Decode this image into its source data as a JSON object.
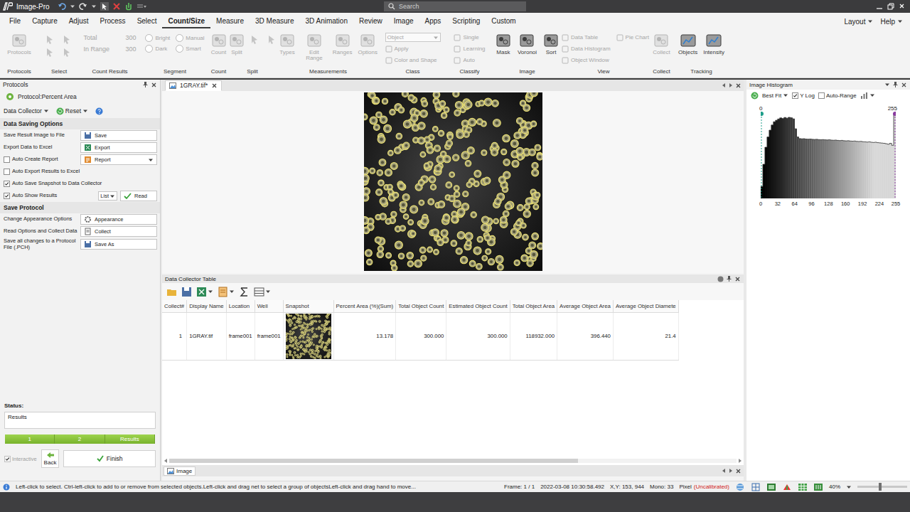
{
  "window": {
    "title": "Image-Pro",
    "search": "Search"
  },
  "menu": {
    "tabs": [
      {
        "label": "File",
        "selected": false
      },
      {
        "label": "Capture",
        "selected": false
      },
      {
        "label": "Adjust",
        "selected": false
      },
      {
        "label": "Process",
        "selected": false
      },
      {
        "label": "Select",
        "selected": false
      },
      {
        "label": "Count/Size",
        "selected": true
      },
      {
        "label": "Measure",
        "selected": false
      },
      {
        "label": "3D Measure",
        "selected": false
      },
      {
        "label": "3D Animation",
        "selected": false
      },
      {
        "label": "Review",
        "selected": false
      },
      {
        "label": "Image",
        "selected": false
      },
      {
        "label": "Apps",
        "selected": false
      },
      {
        "label": "Scripting",
        "selected": false
      },
      {
        "label": "Custom",
        "selected": false
      }
    ],
    "right": [
      "Layout",
      "Help"
    ]
  },
  "ribbon": [
    {
      "label": "Protocols",
      "items": [
        {
          "kind": "large",
          "text": "Protocols",
          "disabled": true
        }
      ]
    },
    {
      "label": "Select",
      "items": [
        {
          "kind": "icon",
          "disabled": true
        },
        {
          "kind": "icon",
          "disabled": true
        },
        {
          "kind": "icon",
          "disabled": true
        },
        {
          "kind": "icon",
          "disabled": true
        }
      ]
    },
    {
      "label": "Count Results",
      "items": [
        {
          "kind": "value",
          "text": "Total",
          "value": "300",
          "disabled": true
        },
        {
          "kind": "value",
          "text": "In Range",
          "value": "300",
          "disabled": true
        }
      ]
    },
    {
      "label": "Segment",
      "items": [
        {
          "kind": "radio",
          "text": "Bright",
          "selected": false,
          "disabled": true
        },
        {
          "kind": "radio",
          "text": "Manual",
          "selected": false,
          "disabled": true
        },
        {
          "kind": "radio",
          "text": "Dark",
          "selected": false,
          "disabled": true
        },
        {
          "kind": "radio",
          "text": "Smart",
          "selected": false,
          "disabled": true
        }
      ]
    },
    {
      "label": "Count",
      "items": [
        {
          "kind": "large",
          "text": "Count",
          "disabled": true
        }
      ]
    },
    {
      "label": "Split",
      "items": [
        {
          "kind": "large",
          "text": "Split",
          "disabled": true
        },
        {
          "kind": "icon",
          "disabled": true
        },
        {
          "kind": "icon",
          "disabled": true
        }
      ]
    },
    {
      "label": "Measurements",
      "items": [
        {
          "kind": "large",
          "text": "Types",
          "disabled": true
        },
        {
          "kind": "large",
          "text": "Edit Range",
          "disabled": true
        },
        {
          "kind": "large",
          "text": "Ranges",
          "disabled": true
        },
        {
          "kind": "large",
          "text": "Options",
          "disabled": true
        }
      ]
    },
    {
      "label": "Class",
      "items": [
        {
          "kind": "dropdown",
          "text": "Object",
          "disabled": true
        },
        {
          "kind": "small",
          "text": "Apply",
          "disabled": true
        },
        {
          "kind": "small",
          "text": "Color and Shape",
          "disabled": true
        }
      ]
    },
    {
      "label": "Classify",
      "items": [
        {
          "kind": "small",
          "text": "Single",
          "disabled": true
        },
        {
          "kind": "small",
          "text": "Learning",
          "disabled": true
        },
        {
          "kind": "small",
          "text": "Auto",
          "disabled": true
        }
      ]
    },
    {
      "label": "Image",
      "items": [
        {
          "kind": "large",
          "text": "Mask",
          "disabled": false
        },
        {
          "kind": "large",
          "text": "Voronoi",
          "disabled": false
        },
        {
          "kind": "large",
          "text": "Sort",
          "disabled": false
        }
      ]
    },
    {
      "label": "View",
      "items": [
        {
          "kind": "small",
          "text": "Data Table",
          "disabled": true
        },
        {
          "kind": "small",
          "text": "Data Histogram",
          "disabled": true
        },
        {
          "kind": "small",
          "text": "Object Window",
          "disabled": true
        },
        {
          "kind": "small",
          "text": "Pie Chart",
          "disabled": true
        }
      ]
    },
    {
      "label": "Collect",
      "items": [
        {
          "kind": "large",
          "text": "Collect",
          "disabled": true
        }
      ]
    },
    {
      "label": "Tracking",
      "items": [
        {
          "kind": "large",
          "text": "Objects",
          "disabled": false
        },
        {
          "kind": "large",
          "text": "Intensity",
          "disabled": false
        }
      ]
    }
  ],
  "protocols_panel": {
    "title": "Protocols",
    "protocol": "Protocol:Percent Area",
    "collector": "Data Collector",
    "reset": "Reset",
    "sections": [
      {
        "title": "Data Saving Options",
        "rows": [
          {
            "kind": "button",
            "label": "Save Result Image to File",
            "button": "Save"
          },
          {
            "kind": "button",
            "label": "Export Data to Excel",
            "button": "Export"
          },
          {
            "kind": "check-dropdown",
            "label": "Auto Create Report",
            "checked": false,
            "button": "Report"
          },
          {
            "kind": "check",
            "label": "Auto Export Results to Excel",
            "checked": false
          },
          {
            "kind": "check",
            "label": "Auto Save Snapshot to Data Collector",
            "checked": true
          },
          {
            "kind": "check-list",
            "label": "Auto Show Results",
            "checked": true,
            "select": "List",
            "button": "Read"
          }
        ]
      },
      {
        "title": "Save Protocol",
        "rows": [
          {
            "kind": "button",
            "label": "Change Appearance Options",
            "button": "Appearance"
          },
          {
            "kind": "button",
            "label": "Read Options and Collect Data",
            "button": "Collect"
          },
          {
            "kind": "button",
            "label": "Save all changes to a Protocol File (.PCH)",
            "button": "Save As"
          }
        ]
      }
    ],
    "status_label": "Status:",
    "status": "Results",
    "steps": [
      {
        "label": "1",
        "done": true
      },
      {
        "label": "2",
        "done": true
      },
      {
        "label": "Results",
        "done": true
      }
    ],
    "interactive": {
      "label": "Interactive",
      "checked": true,
      "disabled": true
    },
    "back": "Back",
    "finish": "Finish"
  },
  "document": {
    "tab": {
      "label": "1GRAY.tif*",
      "selected": true
    },
    "bottom_tab": {
      "label": "Image",
      "selected": true
    }
  },
  "data_collector": {
    "title": "Data Collector Table",
    "columns": [
      {
        "label": "Collect#",
        "kind": "text"
      },
      {
        "label": "Display Name",
        "kind": "text"
      },
      {
        "label": "Location",
        "kind": "text"
      },
      {
        "label": "Well",
        "kind": "text"
      },
      {
        "label": "Snapshot",
        "kind": "picture"
      },
      {
        "label": "Percent Area (%)(Sum)",
        "kind": "number"
      },
      {
        "label": "Total Object Count",
        "kind": "number"
      },
      {
        "label": "Estimated Object Count",
        "kind": "number"
      },
      {
        "label": "Total Object Area",
        "kind": "number"
      },
      {
        "label": "Average Object Area",
        "kind": "number"
      },
      {
        "label": "Average Object Diamete",
        "kind": "number"
      }
    ],
    "rows": [
      {
        "cells": [
          "1",
          "1GRAY.tif",
          "frame001",
          "frame001",
          null,
          "13.178",
          "300.000",
          "300.000",
          "118932.000",
          "396.440",
          "21.4"
        ]
      }
    ]
  },
  "histogram": {
    "title": "Image Histogram",
    "fit": "Best Fit",
    "y_log": {
      "label": "Y Log",
      "checked": true
    },
    "auto_range": {
      "label": "Auto-Range",
      "checked": false
    },
    "range_low": "0",
    "range_high": "255",
    "ticks": [
      "0",
      "32",
      "64",
      "96",
      "128",
      "160",
      "192",
      "224",
      "255"
    ],
    "values": [
      5,
      100,
      1000,
      4000,
      10000,
      20000,
      31000,
      38000,
      45000,
      52000,
      48000,
      55000,
      50000,
      56000,
      53000,
      46000,
      12000,
      4000,
      3200,
      3100,
      3150,
      3000,
      2950,
      3000,
      2900,
      2850,
      2900,
      2800,
      2750,
      2800,
      2700,
      2650,
      2700,
      2600,
      2550,
      2600,
      2500,
      2450,
      2500,
      2400,
      2350,
      2400,
      2300,
      2250,
      2300,
      2200,
      2150,
      2200,
      2100,
      2050,
      2000,
      2050,
      1950,
      1900,
      1950,
      1850,
      1800,
      1750,
      1700,
      1600,
      1500,
      1700,
      1300,
      100000
    ]
  },
  "status_bar": {
    "hint": "Left-click to select. Ctrl-left-click to add to or remove from selected objects.Left-click and drag net to select a group of objectsLeft-click and drag hand to move...",
    "frame": "Frame: 1 / 1",
    "timestamp": "2022-03-08 10:30:58.492",
    "xy": "X,Y: 153, 944",
    "mono": "Mono: 33",
    "pixel": "Pixel",
    "calibration": "(Uncalibrated)",
    "zoom": "40%",
    "zoom_level": 0.45
  }
}
